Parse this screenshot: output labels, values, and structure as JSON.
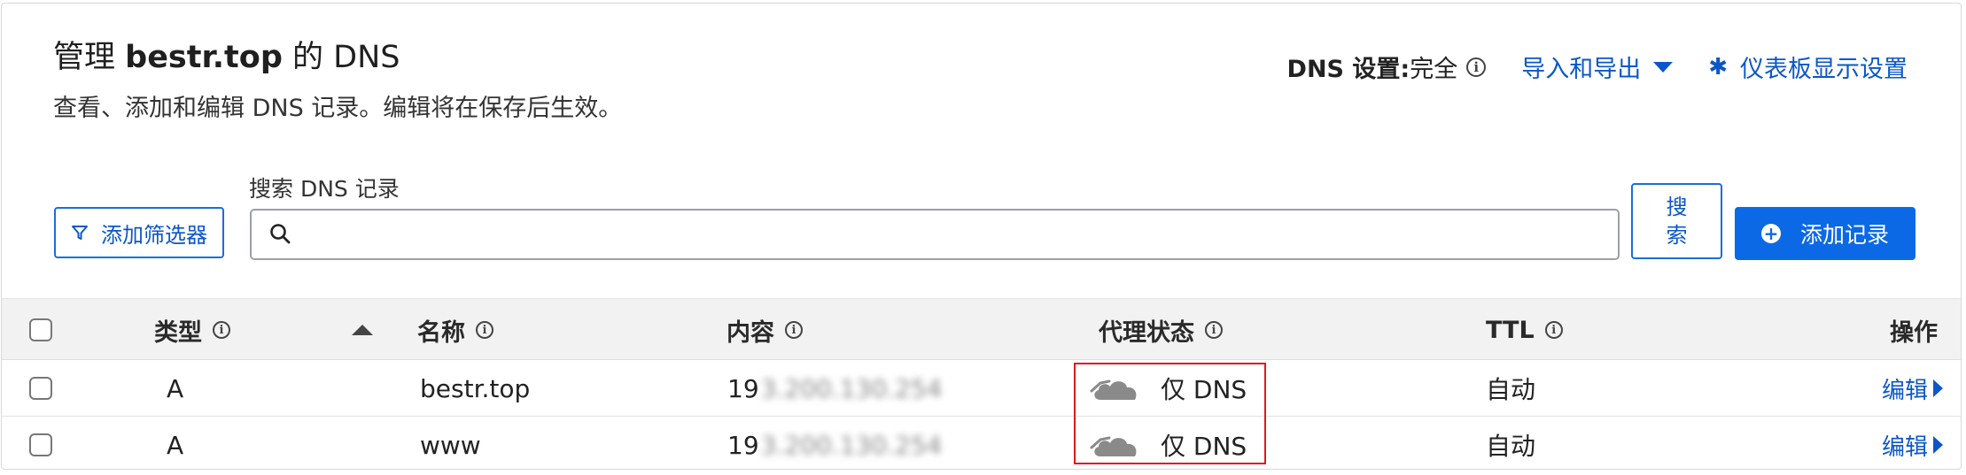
{
  "header": {
    "title_prefix": "管理 ",
    "title_domain": "bestr.top",
    "title_suffix": " 的 DNS",
    "subtitle": "查看、添加和编辑 DNS 记录。编辑将在保存后生效。",
    "dns_setting_label": "DNS 设置:",
    "dns_setting_value": "完全",
    "import_export": "导入和导出",
    "dashboard_settings": "仪表板显示设置"
  },
  "toolbar": {
    "filter_button": "添加筛选器",
    "search_label": "搜索 DNS 记录",
    "search_value": "",
    "search_placeholder": "",
    "search_button": "搜索",
    "add_record_button": "添加记录"
  },
  "table": {
    "columns": {
      "type": "类型",
      "name": "名称",
      "content": "内容",
      "proxy_status": "代理状态",
      "ttl": "TTL",
      "actions": "操作"
    },
    "rows": [
      {
        "type": "A",
        "name": "bestr.top",
        "content_visible": "19",
        "content_blurred": "3.200.130.254",
        "proxy_status": "仅 DNS",
        "ttl": "自动",
        "action": "编辑"
      },
      {
        "type": "A",
        "name": "www",
        "content_visible": "19",
        "content_blurred": "3.200.130.254",
        "proxy_status": "仅 DNS",
        "ttl": "自动",
        "action": "编辑"
      }
    ]
  },
  "colors": {
    "accent": "#0b57c8",
    "primary_button": "#0b69e6",
    "highlight_border": "#e0171e",
    "header_bg": "#f2f2f2"
  },
  "icons": {
    "info": "info-icon",
    "caret": "caret-down-icon",
    "gear": "gear-icon",
    "filter": "filter-icon",
    "search": "search-icon",
    "plus": "plus-circle-icon",
    "cloud": "cloud-dns-only-icon",
    "sort": "sort-ascending-icon",
    "edit_arrow": "triangle-right-icon"
  }
}
